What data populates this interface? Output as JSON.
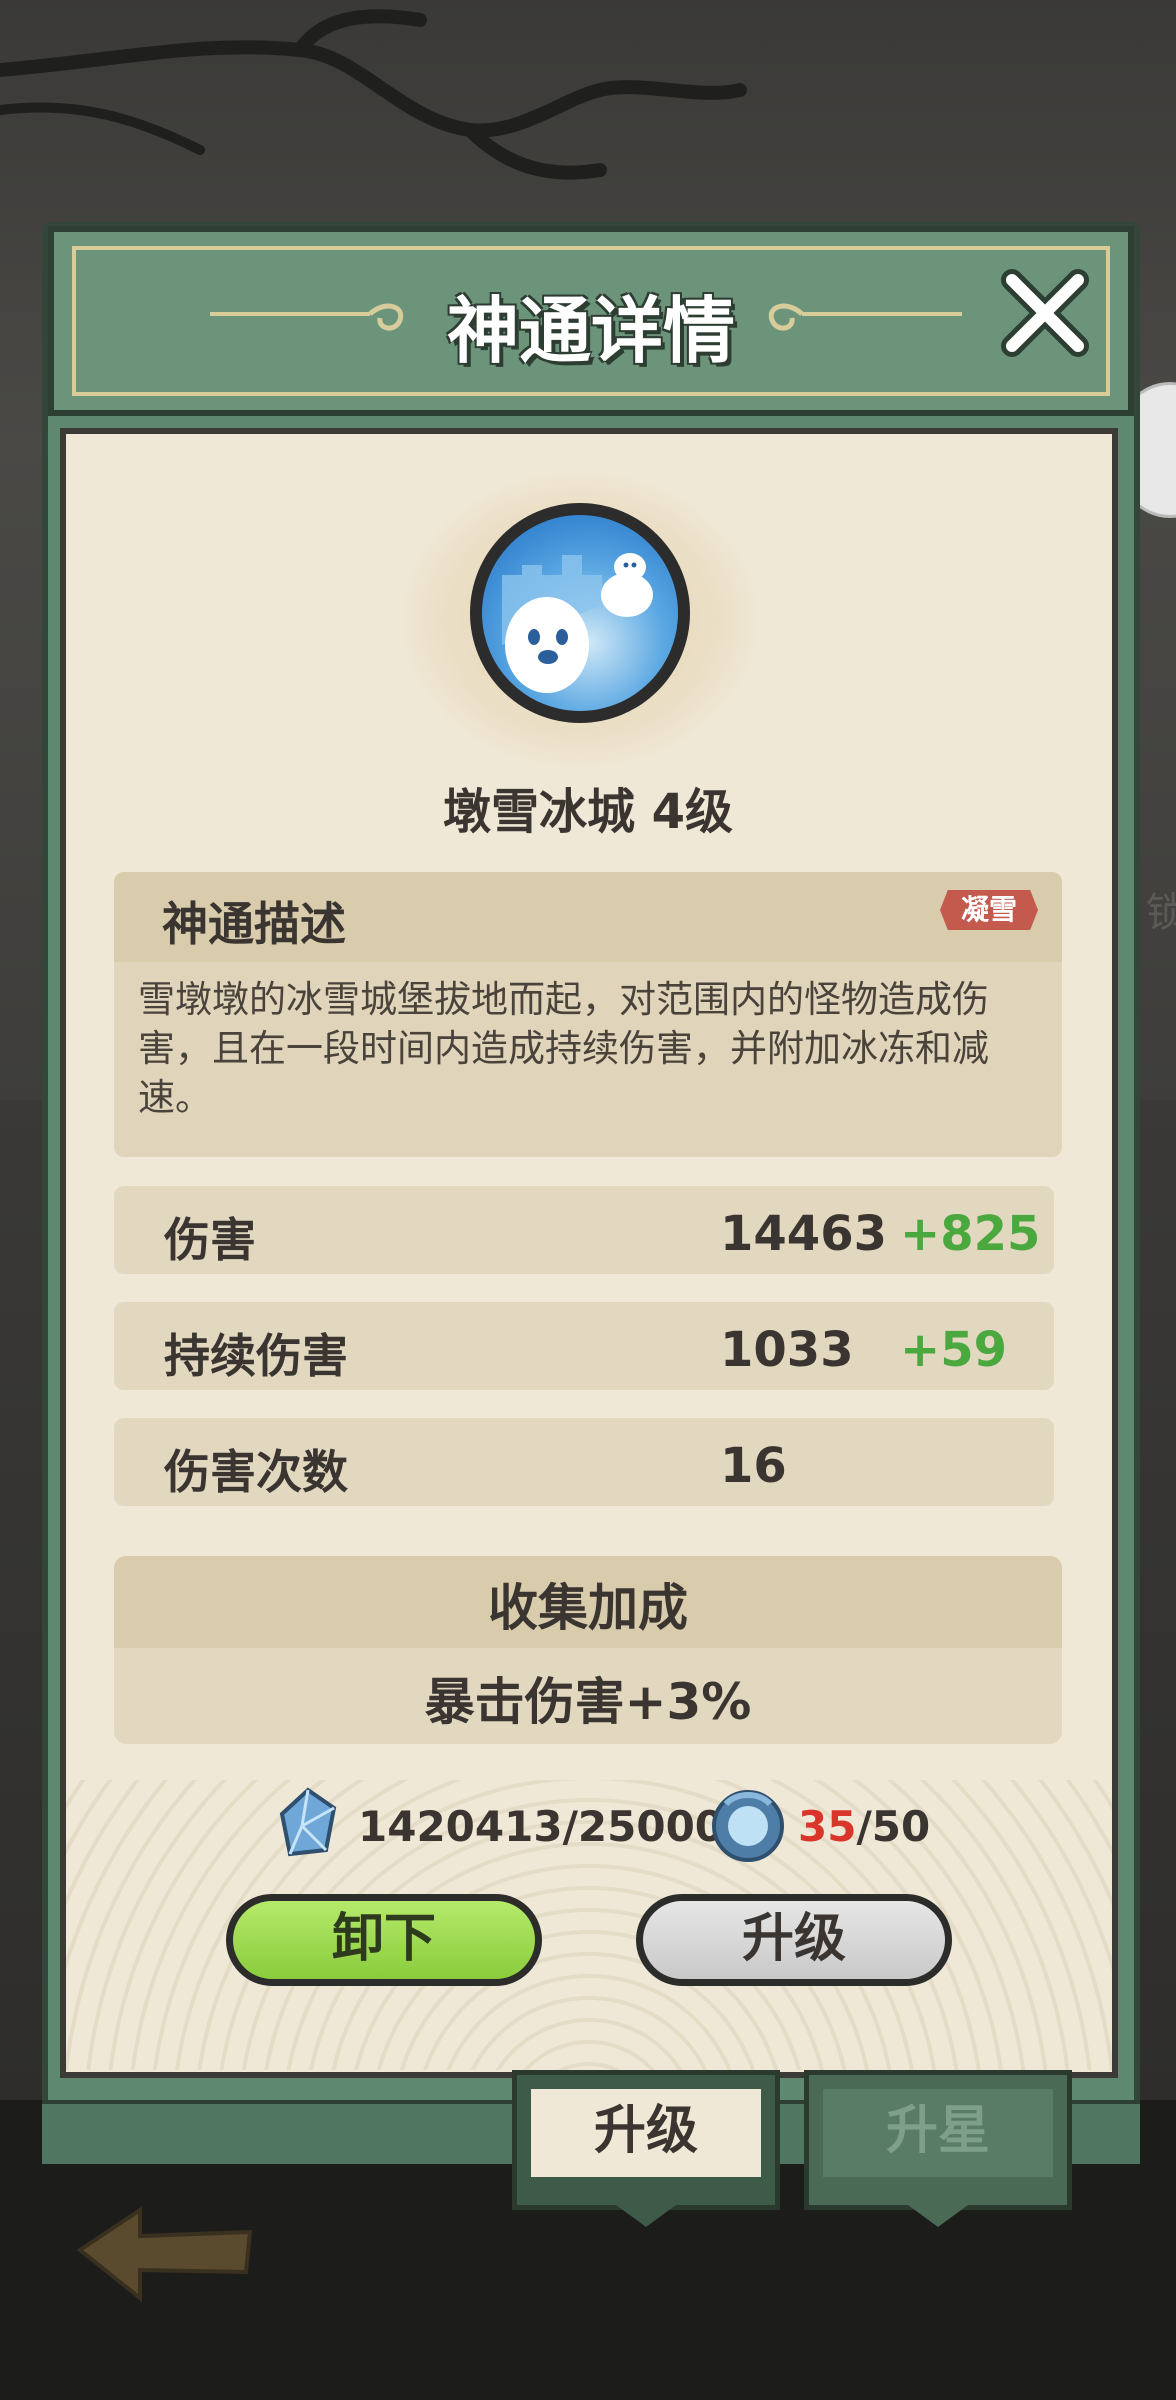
{
  "header": {
    "title": "神通详情"
  },
  "skill": {
    "name": "墩雪冰城 4级",
    "description_title": "神通描述",
    "tag": "凝雪",
    "description": "雪墩墩的冰雪城堡拔地而起，对范围内的怪物造成伤害，且在一段时间内造成持续伤害，并附加冰冻和减速。"
  },
  "stats": [
    {
      "label": "伤害",
      "value": "14463",
      "bonus": "+825"
    },
    {
      "label": "持续伤害",
      "value": "1033",
      "bonus": "+59"
    },
    {
      "label": "伤害次数",
      "value": "16",
      "bonus": ""
    }
  ],
  "collection": {
    "title": "收集加成",
    "text": "暴击伤害+3%"
  },
  "cost": {
    "crystal": "1420413/25000",
    "fragment_current": "35",
    "fragment_total": "/50"
  },
  "buttons": {
    "unequip": "卸下",
    "upgrade": "升级"
  },
  "tabs": [
    {
      "label": "升级",
      "active": true
    },
    {
      "label": "升星",
      "active": false
    }
  ],
  "side_text": "锁",
  "colors": {
    "frame_green": "#5f8870",
    "paper": "#f0e8d6",
    "bonus_green": "#4aa83e",
    "fragment_red": "#d9352b",
    "tag_red": "#c45a4e"
  }
}
